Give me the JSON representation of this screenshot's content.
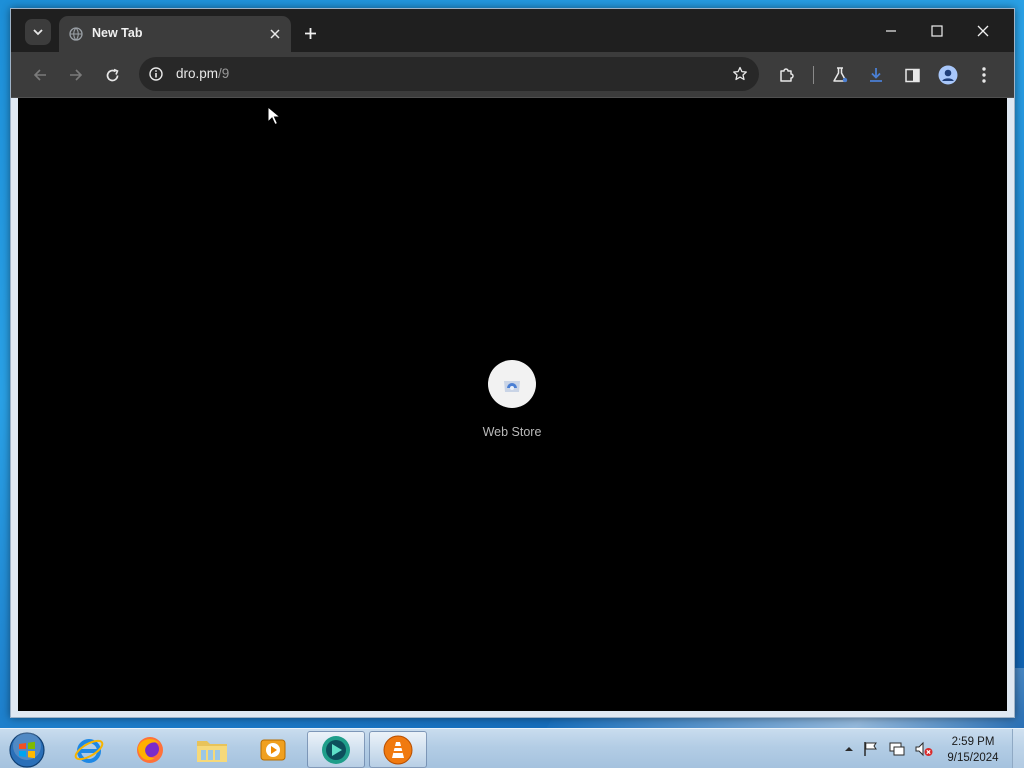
{
  "browser": {
    "tab": {
      "title": "New Tab",
      "favicon": "globe-icon"
    },
    "omnibox": {
      "domain": "dro.pm",
      "path": "/9",
      "info_icon": "info-icon"
    },
    "toolbar_icons": [
      "back-icon",
      "forward-icon",
      "reload-icon",
      "bookmark-star-icon",
      "extensions-icon",
      "labs-flask-icon",
      "download-icon",
      "side-panel-icon",
      "profile-icon",
      "menu-icon"
    ],
    "window_controls": [
      "minimize-icon",
      "maximize-icon",
      "close-icon"
    ]
  },
  "page": {
    "shortcut": {
      "label": "Web Store",
      "icon": "web-store-icon"
    }
  },
  "taskbar": {
    "apps": [
      "internet-explorer-icon",
      "firefox-icon",
      "file-explorer-icon",
      "media-player-icon",
      "app-circle-icon",
      "vlc-icon"
    ],
    "tray_icons": [
      "show-hidden-icons-icon",
      "action-center-flag-icon",
      "network-icon",
      "volume-muted-icon"
    ],
    "clock": {
      "time": "2:59 PM",
      "date": "9/15/2024"
    }
  },
  "colors": {
    "titlebar": "#1f1f1f",
    "toolbar": "#3c3c3c",
    "content": "#000000",
    "accent": "#4a7fd4"
  }
}
